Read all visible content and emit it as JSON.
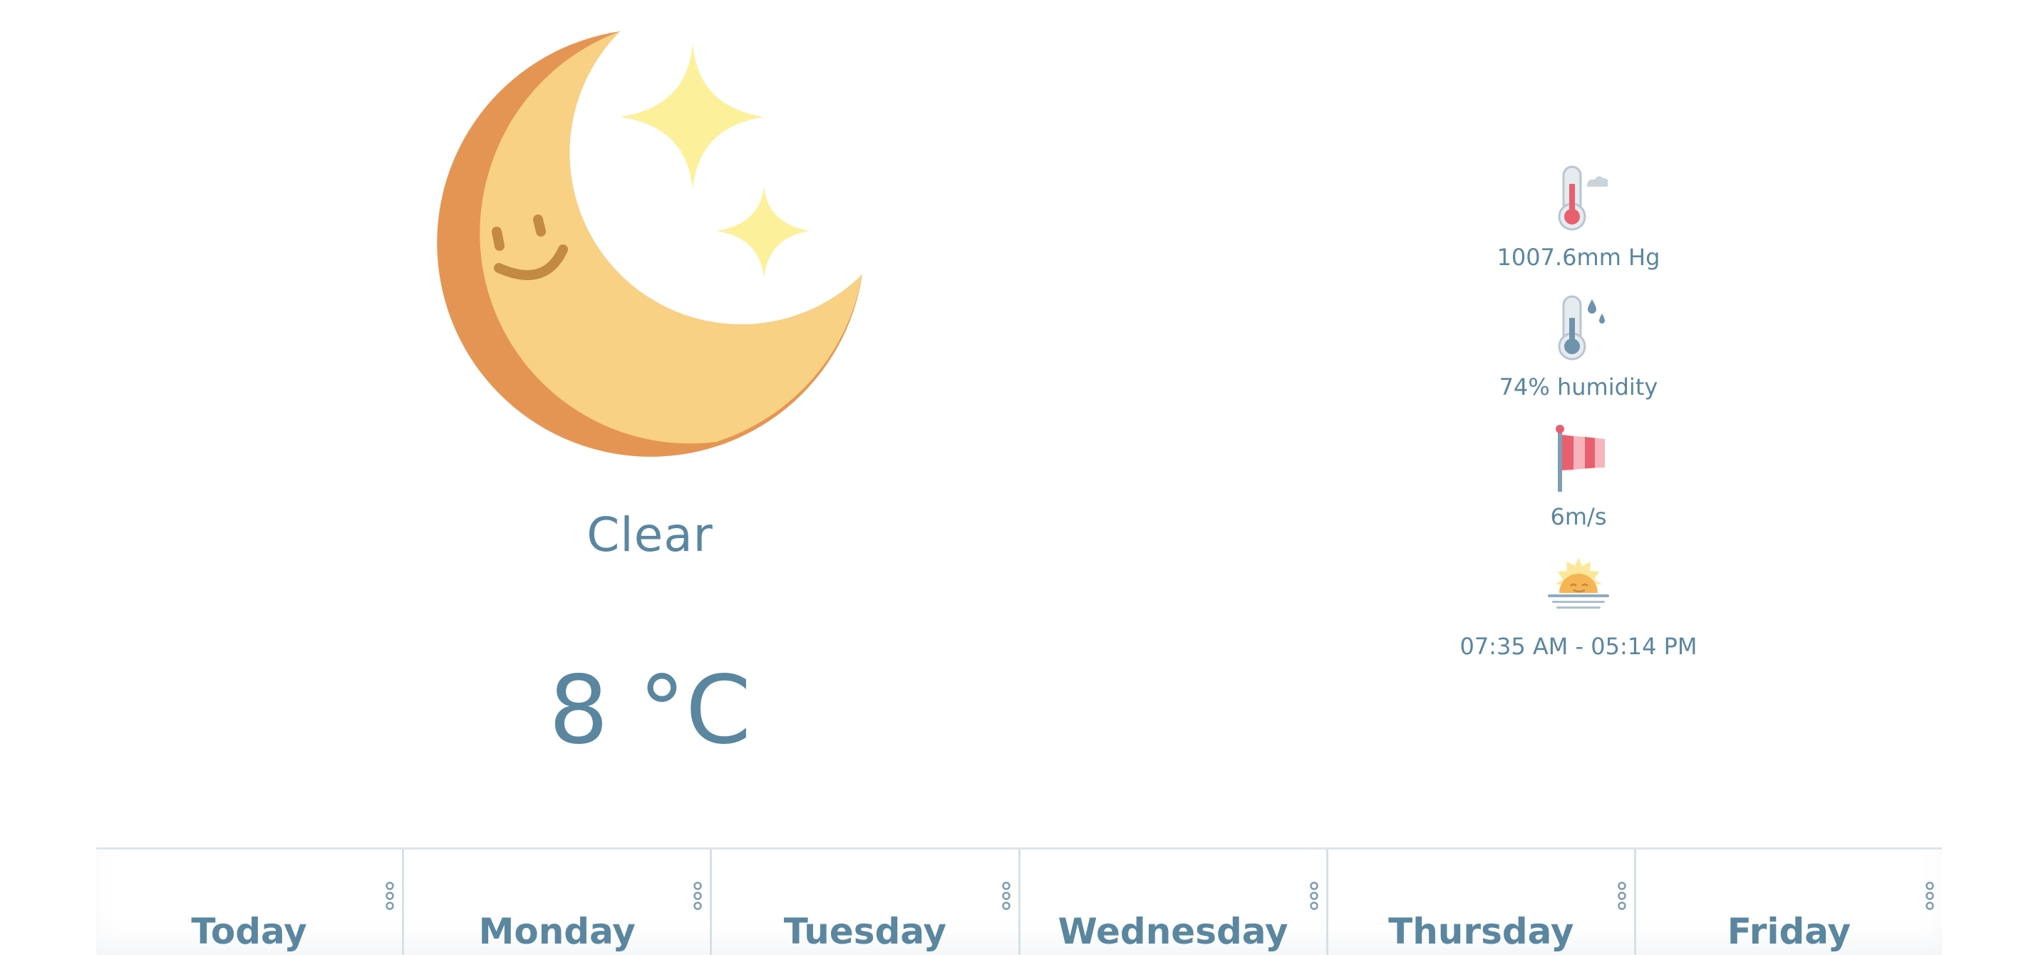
{
  "current": {
    "condition": "Clear",
    "temperature": "8 °C",
    "icon": "clear-night-moon-icon"
  },
  "details": [
    {
      "icon": "thermometer-cloud-icon",
      "text": "1007.6mm Hg"
    },
    {
      "icon": "thermometer-humidity-icon",
      "text": "74% humidity"
    },
    {
      "icon": "windsock-icon",
      "text": "6m/s"
    },
    {
      "icon": "sunrise-icon",
      "text": "07:35 AM - 05:14 PM"
    }
  ],
  "days": [
    {
      "name": "Today"
    },
    {
      "name": "Monday"
    },
    {
      "name": "Tuesday"
    },
    {
      "name": "Wednesday"
    },
    {
      "name": "Thursday"
    },
    {
      "name": "Friday"
    }
  ],
  "colors": {
    "text": "#5a86a0",
    "moon_light": "#f8d184",
    "moon_dark": "#e59553",
    "stars": "#fdf09b",
    "divider": "#dde5ea"
  }
}
